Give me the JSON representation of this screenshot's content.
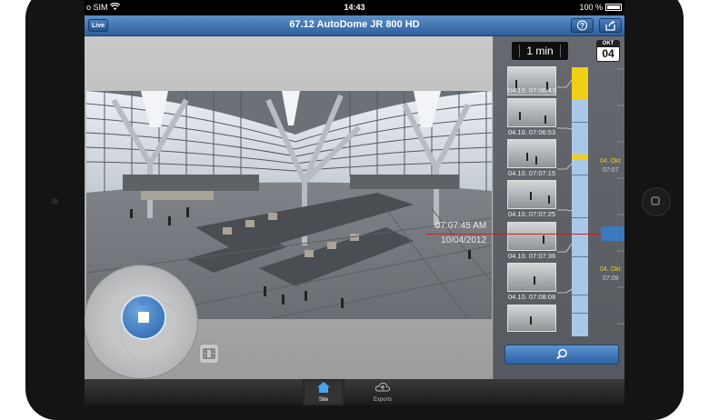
{
  "status": {
    "carrier": "o SIM",
    "time": "14:43",
    "battery": "100 %"
  },
  "nav": {
    "live_label": "Live",
    "title": "67.12 AutoDome JR 800 HD",
    "help_icon": "help-icon",
    "share_icon": "share-icon"
  },
  "video": {
    "time": "07:07:45 AM",
    "date": "10/04/2012"
  },
  "controls": {
    "stop_icon": "stop-icon",
    "filmstrip_icon": "filmstrip-icon"
  },
  "sidebar": {
    "interval": "1 min",
    "calendar": {
      "month": "OKT",
      "day": "04"
    },
    "thumbnails": [
      {
        "label": "04.10. 07:06:43"
      },
      {
        "label": "04.10. 07:06:53"
      },
      {
        "label": "04.10. 07:07:15"
      },
      {
        "label": "04.10. 07:07:25"
      },
      {
        "label": "04.10. 07:07:36"
      },
      {
        "label": "04.10. 07:08:08"
      },
      {
        "label": ""
      }
    ],
    "scale": {
      "label1_day": "04. Okt",
      "label1_time": "07:07",
      "label2_day": "04. Okt",
      "label2_time": "07:08"
    },
    "search_icon": "search-icon"
  },
  "tabs": [
    {
      "label": "Site",
      "icon": "home-icon",
      "selected": true
    },
    {
      "label": "Exports",
      "icon": "cloud-icon",
      "selected": false
    }
  ],
  "colors": {
    "accent": "#2c62a6",
    "timeline": "#a9c8e7",
    "highlight": "#f1cf15",
    "playhead": "#cc2222"
  }
}
